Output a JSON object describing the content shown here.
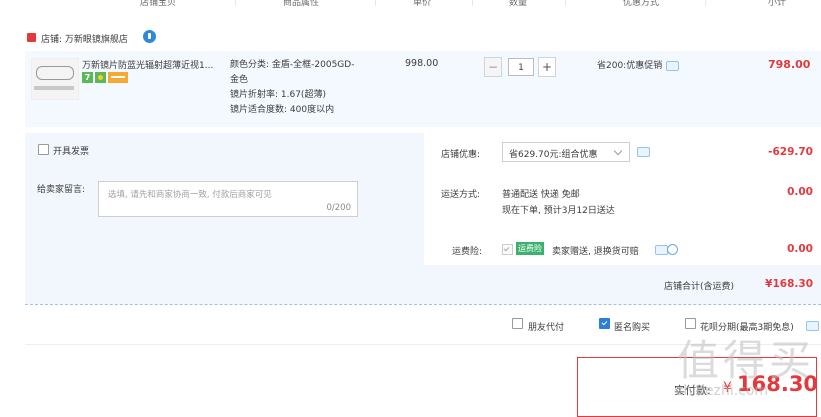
{
  "header": {
    "columns": [
      "店铺宝贝",
      "商品属性",
      "单价",
      "数量",
      "优惠方式",
      "小计"
    ]
  },
  "shop": {
    "name": "店铺: 万新眼镜旗舰店"
  },
  "item": {
    "title": "万新镜片防蓝光辐射超薄近视1...",
    "badge_number": "7",
    "attrs": {
      "category": "颜色分类: 金盾-全框-2005GD-",
      "category_cont": "金色",
      "index": "镜片折射率: 1.67(超薄)",
      "degree": "镜片适合度数: 400度以内"
    },
    "unit_price": "998.00",
    "qty_minus": "−",
    "qty_value": "1",
    "qty_plus": "+",
    "promo": "省200:优惠促销",
    "subtotal": "798.00"
  },
  "order": {
    "invoice_label": "开具发票",
    "shop_discount_label": "店铺优惠:",
    "shop_discount_value": "省629.70元:组合优惠",
    "shop_discount_amount": "-629.70",
    "message_label": "给卖家留言:",
    "message_placeholder": "选填, 请先和商家协商一致, 付款后商家可见",
    "message_count": "0/200",
    "shipping_label": "运送方式:",
    "shipping_method": "普通配送 快递 免邮",
    "shipping_eta": "现在下单, 预计3月12日送达",
    "shipping_fee": "0.00",
    "insurance_label": "运费险:",
    "insurance_badge": "运费险",
    "insurance_text": "卖家赠送, 退换货可赔",
    "insurance_fee": "0.00",
    "shop_total_label": "店铺合计(含运费)",
    "shop_total_value": "¥168.30"
  },
  "options": {
    "friend_pay": "朋友代付",
    "anonymous": "匿名购买",
    "huabei": "花呗分期(最高3期免息)"
  },
  "final": {
    "label": "实付款:",
    "currency": "¥",
    "amount": "168.30"
  },
  "watermark": {
    "main": "值得买",
    "sub": "zhidezhi.com"
  },
  "colors": {
    "accent_red": "#e4393c",
    "accent_blue": "#2c7fd8",
    "row_bg": "#f3f9ff"
  }
}
